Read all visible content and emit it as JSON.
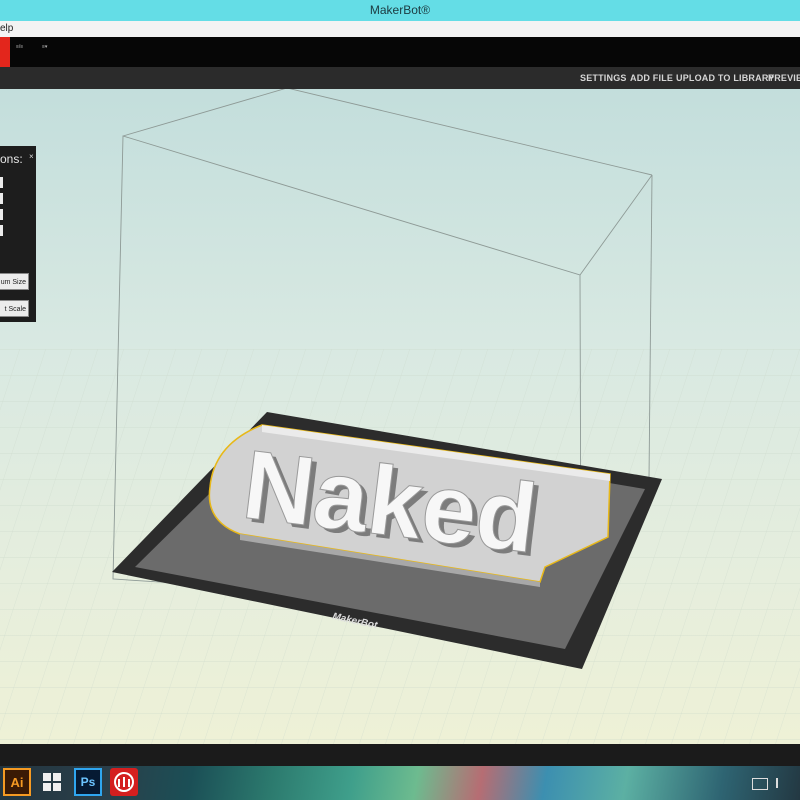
{
  "window": {
    "title": "MakerBot®"
  },
  "menubar": {
    "partial_label": "elp"
  },
  "header": {
    "tiny_labels": [
      "≡/≡",
      "≡▾"
    ]
  },
  "nav": {
    "items": [
      "SETTINGS",
      "ADD FILE",
      "UPLOAD TO LIBRARY",
      "PREVIEW"
    ]
  },
  "panel": {
    "title": "ons:",
    "close": "×",
    "buttons": [
      "um Size",
      "t Scale"
    ]
  },
  "scene": {
    "model_text": "Naked",
    "plate_brand": "MakerBot"
  },
  "taskbar": {
    "icons": [
      "illustrator-icon",
      "windows-icon",
      "photoshop-icon",
      "makerbot-icon"
    ],
    "labels": {
      "illustrator": "Ai",
      "photoshop": "Ps"
    }
  },
  "colors": {
    "title_bar": "#64dde6",
    "accent_red": "#e3261c",
    "model_outline": "#e8b818"
  }
}
